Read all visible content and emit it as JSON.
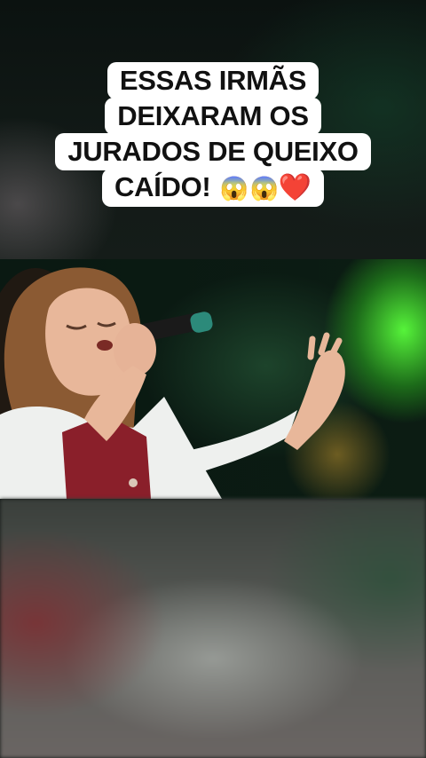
{
  "caption": {
    "line1": "ESSAS IRMÃS",
    "line2": "DEIXARAM OS",
    "line3": "JURADOS DE QUEIXO",
    "line4_text": "CAÍDO!",
    "emoji1": "😱",
    "emoji2": "😱",
    "emoji3": "❤️"
  },
  "video": {
    "icon": "singer-video-frame"
  },
  "colors": {
    "caption_bg": "#ffffff",
    "caption_text": "#111111",
    "stage_green": "#5aff3c"
  }
}
